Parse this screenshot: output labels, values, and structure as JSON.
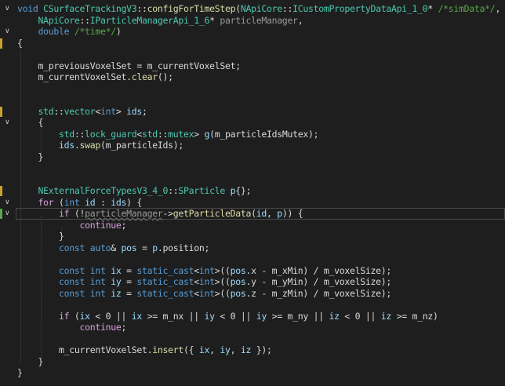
{
  "editor": {
    "lines": [
      {
        "fold": "∨",
        "mark": "",
        "tokens": [
          {
            "t": "void ",
            "c": "keyword"
          },
          {
            "t": "CSurfaceTrackingV3",
            "c": "type"
          },
          {
            "t": "::",
            "c": "punct"
          },
          {
            "t": "configForTimeStep",
            "c": "func"
          },
          {
            "t": "(",
            "c": "punct"
          },
          {
            "t": "NApiCore",
            "c": "ns"
          },
          {
            "t": "::",
            "c": "punct"
          },
          {
            "t": "ICustomPropertyDataApi_1_0",
            "c": "type"
          },
          {
            "t": "* ",
            "c": "punct"
          },
          {
            "t": "/*simData*/",
            "c": "comment"
          },
          {
            "t": ",",
            "c": "punct"
          }
        ]
      },
      {
        "fold": "",
        "mark": "",
        "tokens": [
          {
            "t": "    NApiCore",
            "c": "ns"
          },
          {
            "t": "::",
            "c": "punct"
          },
          {
            "t": "IParticleManagerApi_1_6",
            "c": "type"
          },
          {
            "t": "* ",
            "c": "punct"
          },
          {
            "t": "particleManager",
            "c": "dim"
          },
          {
            "t": ",",
            "c": "punct"
          }
        ]
      },
      {
        "fold": "∨",
        "mark": "",
        "tokens": [
          {
            "t": "    double ",
            "c": "keyword"
          },
          {
            "t": "/*time*/",
            "c": "comment"
          },
          {
            "t": ")",
            "c": "punct"
          }
        ]
      },
      {
        "fold": "",
        "mark": "mod",
        "tokens": [
          {
            "t": "{",
            "c": "punct"
          }
        ]
      },
      {
        "fold": "",
        "mark": "",
        "tokens": []
      },
      {
        "fold": "",
        "mark": "",
        "tokens": [
          {
            "t": "    m_previousVoxelSet",
            "c": "plain"
          },
          {
            "t": " = ",
            "c": "punct"
          },
          {
            "t": "m_currentVoxelSet",
            "c": "plain"
          },
          {
            "t": ";",
            "c": "punct"
          }
        ]
      },
      {
        "fold": "",
        "mark": "",
        "tokens": [
          {
            "t": "    m_currentVoxelSet",
            "c": "plain"
          },
          {
            "t": ".",
            "c": "punct"
          },
          {
            "t": "clear",
            "c": "func"
          },
          {
            "t": "();",
            "c": "punct"
          }
        ]
      },
      {
        "fold": "",
        "mark": "",
        "tokens": []
      },
      {
        "fold": "",
        "mark": "",
        "tokens": []
      },
      {
        "fold": "",
        "mark": "mod",
        "tokens": [
          {
            "t": "    std",
            "c": "ns"
          },
          {
            "t": "::",
            "c": "punct"
          },
          {
            "t": "vector",
            "c": "type"
          },
          {
            "t": "<",
            "c": "punct"
          },
          {
            "t": "int",
            "c": "keyword"
          },
          {
            "t": "> ",
            "c": "punct"
          },
          {
            "t": "ids",
            "c": "var"
          },
          {
            "t": ";",
            "c": "punct"
          }
        ]
      },
      {
        "fold": "∨",
        "mark": "",
        "tokens": [
          {
            "t": "    {",
            "c": "punct"
          }
        ]
      },
      {
        "fold": "",
        "mark": "",
        "tokens": [
          {
            "t": "        std",
            "c": "ns"
          },
          {
            "t": "::",
            "c": "punct"
          },
          {
            "t": "lock_guard",
            "c": "type"
          },
          {
            "t": "<",
            "c": "punct"
          },
          {
            "t": "std",
            "c": "ns"
          },
          {
            "t": "::",
            "c": "punct"
          },
          {
            "t": "mutex",
            "c": "type"
          },
          {
            "t": "> ",
            "c": "punct"
          },
          {
            "t": "g",
            "c": "var"
          },
          {
            "t": "(",
            "c": "punct"
          },
          {
            "t": "m_particleIdsMutex",
            "c": "plain"
          },
          {
            "t": ");",
            "c": "punct"
          }
        ]
      },
      {
        "fold": "",
        "mark": "",
        "tokens": [
          {
            "t": "        ids",
            "c": "var"
          },
          {
            "t": ".",
            "c": "punct"
          },
          {
            "t": "swap",
            "c": "func"
          },
          {
            "t": "(",
            "c": "punct"
          },
          {
            "t": "m_particleIds",
            "c": "plain"
          },
          {
            "t": ");",
            "c": "punct"
          }
        ]
      },
      {
        "fold": "",
        "mark": "",
        "tokens": [
          {
            "t": "    }",
            "c": "punct"
          }
        ]
      },
      {
        "fold": "",
        "mark": "",
        "tokens": []
      },
      {
        "fold": "",
        "mark": "",
        "tokens": []
      },
      {
        "fold": "",
        "mark": "mod",
        "tokens": [
          {
            "t": "    NExternalForceTypesV3_4_0",
            "c": "ns"
          },
          {
            "t": "::",
            "c": "punct"
          },
          {
            "t": "SParticle ",
            "c": "type"
          },
          {
            "t": "p",
            "c": "var"
          },
          {
            "t": "{};",
            "c": "punct"
          }
        ]
      },
      {
        "fold": "∨",
        "mark": "",
        "tokens": [
          {
            "t": "    for ",
            "c": "flow"
          },
          {
            "t": "(",
            "c": "punct"
          },
          {
            "t": "int ",
            "c": "keyword"
          },
          {
            "t": "id",
            "c": "var"
          },
          {
            "t": " : ",
            "c": "punct"
          },
          {
            "t": "ids",
            "c": "var"
          },
          {
            "t": ") {",
            "c": "punct"
          }
        ]
      },
      {
        "fold": "∨",
        "mark": "add",
        "caret": true,
        "tokens": [
          {
            "t": "        if ",
            "c": "flow"
          },
          {
            "t": "(!",
            "c": "punct"
          },
          {
            "t": "particleManager",
            "c": "dim",
            "sq": true
          },
          {
            "t": "->",
            "c": "punct"
          },
          {
            "t": "getParticleData",
            "c": "func"
          },
          {
            "t": "(",
            "c": "punct"
          },
          {
            "t": "id",
            "c": "var"
          },
          {
            "t": ", ",
            "c": "punct"
          },
          {
            "t": "p",
            "c": "var"
          },
          {
            "t": ")) {",
            "c": "punct"
          }
        ]
      },
      {
        "fold": "",
        "mark": "",
        "tokens": [
          {
            "t": "            continue",
            "c": "flow"
          },
          {
            "t": ";",
            "c": "punct"
          }
        ]
      },
      {
        "fold": "",
        "mark": "",
        "tokens": [
          {
            "t": "        }",
            "c": "punct"
          }
        ]
      },
      {
        "fold": "",
        "mark": "",
        "tokens": [
          {
            "t": "        const ",
            "c": "keyword"
          },
          {
            "t": "auto",
            "c": "keyword"
          },
          {
            "t": "& ",
            "c": "punct"
          },
          {
            "t": "pos",
            "c": "var"
          },
          {
            "t": " = ",
            "c": "punct"
          },
          {
            "t": "p",
            "c": "var"
          },
          {
            "t": ".",
            "c": "punct"
          },
          {
            "t": "position",
            "c": "plain"
          },
          {
            "t": ";",
            "c": "punct"
          }
        ]
      },
      {
        "fold": "",
        "mark": "",
        "tokens": []
      },
      {
        "fold": "",
        "mark": "",
        "tokens": [
          {
            "t": "        const ",
            "c": "keyword"
          },
          {
            "t": "int ",
            "c": "keyword"
          },
          {
            "t": "ix",
            "c": "var"
          },
          {
            "t": " = ",
            "c": "punct"
          },
          {
            "t": "static_cast",
            "c": "keyword"
          },
          {
            "t": "<",
            "c": "punct"
          },
          {
            "t": "int",
            "c": "keyword"
          },
          {
            "t": ">((",
            "c": "punct"
          },
          {
            "t": "pos",
            "c": "var"
          },
          {
            "t": ".",
            "c": "punct"
          },
          {
            "t": "x",
            "c": "plain"
          },
          {
            "t": " - ",
            "c": "punct"
          },
          {
            "t": "m_xMin",
            "c": "plain"
          },
          {
            "t": ") / ",
            "c": "punct"
          },
          {
            "t": "m_voxelSize",
            "c": "plain"
          },
          {
            "t": ");",
            "c": "punct"
          }
        ]
      },
      {
        "fold": "",
        "mark": "",
        "tokens": [
          {
            "t": "        const ",
            "c": "keyword"
          },
          {
            "t": "int ",
            "c": "keyword"
          },
          {
            "t": "iy",
            "c": "var"
          },
          {
            "t": " = ",
            "c": "punct"
          },
          {
            "t": "static_cast",
            "c": "keyword"
          },
          {
            "t": "<",
            "c": "punct"
          },
          {
            "t": "int",
            "c": "keyword"
          },
          {
            "t": ">((",
            "c": "punct"
          },
          {
            "t": "pos",
            "c": "var"
          },
          {
            "t": ".",
            "c": "punct"
          },
          {
            "t": "y",
            "c": "plain"
          },
          {
            "t": " - ",
            "c": "punct"
          },
          {
            "t": "m_yMin",
            "c": "plain"
          },
          {
            "t": ") / ",
            "c": "punct"
          },
          {
            "t": "m_voxelSize",
            "c": "plain"
          },
          {
            "t": ");",
            "c": "punct"
          }
        ]
      },
      {
        "fold": "",
        "mark": "",
        "tokens": [
          {
            "t": "        const ",
            "c": "keyword"
          },
          {
            "t": "int ",
            "c": "keyword"
          },
          {
            "t": "iz",
            "c": "var"
          },
          {
            "t": " = ",
            "c": "punct"
          },
          {
            "t": "static_cast",
            "c": "keyword"
          },
          {
            "t": "<",
            "c": "punct"
          },
          {
            "t": "int",
            "c": "keyword"
          },
          {
            "t": ">((",
            "c": "punct"
          },
          {
            "t": "pos",
            "c": "var"
          },
          {
            "t": ".",
            "c": "punct"
          },
          {
            "t": "z",
            "c": "plain"
          },
          {
            "t": " - ",
            "c": "punct"
          },
          {
            "t": "m_zMin",
            "c": "plain"
          },
          {
            "t": ") / ",
            "c": "punct"
          },
          {
            "t": "m_voxelSize",
            "c": "plain"
          },
          {
            "t": ");",
            "c": "punct"
          }
        ]
      },
      {
        "fold": "",
        "mark": "",
        "tokens": []
      },
      {
        "fold": "",
        "mark": "",
        "tokens": [
          {
            "t": "        if ",
            "c": "flow"
          },
          {
            "t": "(",
            "c": "punct"
          },
          {
            "t": "ix",
            "c": "var"
          },
          {
            "t": " < 0 || ",
            "c": "punct"
          },
          {
            "t": "ix",
            "c": "var"
          },
          {
            "t": " >= ",
            "c": "punct"
          },
          {
            "t": "m_nx",
            "c": "plain"
          },
          {
            "t": " || ",
            "c": "punct"
          },
          {
            "t": "iy",
            "c": "var"
          },
          {
            "t": " < 0 || ",
            "c": "punct"
          },
          {
            "t": "iy",
            "c": "var"
          },
          {
            "t": " >= ",
            "c": "punct"
          },
          {
            "t": "m_ny",
            "c": "plain"
          },
          {
            "t": " || ",
            "c": "punct"
          },
          {
            "t": "iz",
            "c": "var"
          },
          {
            "t": " < 0 || ",
            "c": "punct"
          },
          {
            "t": "iz",
            "c": "var"
          },
          {
            "t": " >= ",
            "c": "punct"
          },
          {
            "t": "m_nz",
            "c": "plain"
          },
          {
            "t": ")",
            "c": "punct"
          }
        ]
      },
      {
        "fold": "",
        "mark": "",
        "tokens": [
          {
            "t": "            continue",
            "c": "flow"
          },
          {
            "t": ";",
            "c": "punct"
          }
        ]
      },
      {
        "fold": "",
        "mark": "",
        "tokens": []
      },
      {
        "fold": "",
        "mark": "",
        "tokens": [
          {
            "t": "        m_currentVoxelSet",
            "c": "plain"
          },
          {
            "t": ".",
            "c": "punct"
          },
          {
            "t": "insert",
            "c": "func"
          },
          {
            "t": "({ ",
            "c": "punct"
          },
          {
            "t": "ix",
            "c": "var"
          },
          {
            "t": ", ",
            "c": "punct"
          },
          {
            "t": "iy",
            "c": "var"
          },
          {
            "t": ", ",
            "c": "punct"
          },
          {
            "t": "iz",
            "c": "var"
          },
          {
            "t": " });",
            "c": "punct"
          }
        ]
      },
      {
        "fold": "",
        "mark": "",
        "tokens": [
          {
            "t": "    }",
            "c": "punct"
          }
        ]
      },
      {
        "fold": "",
        "mark": "",
        "tokens": [
          {
            "t": "}",
            "c": "punct"
          }
        ]
      }
    ]
  }
}
